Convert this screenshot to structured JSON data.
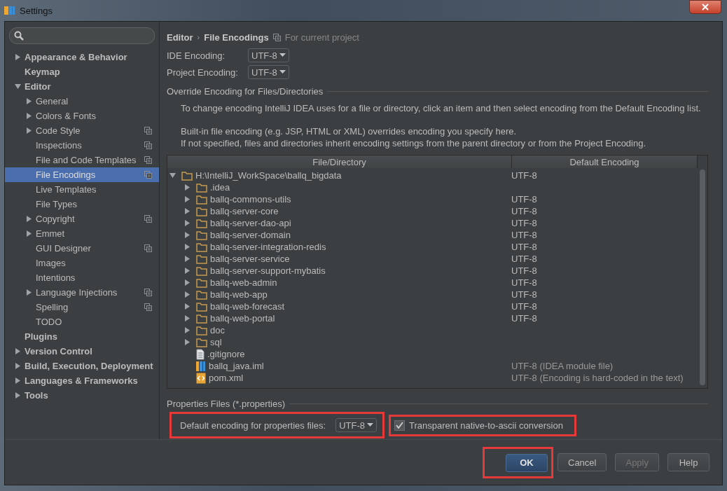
{
  "window": {
    "title": "Settings"
  },
  "sidebar": {
    "items": [
      {
        "label": "Appearance & Behavior",
        "expanded": false,
        "selected": false
      },
      {
        "label": "Keymap",
        "selected": false
      },
      {
        "label": "Editor",
        "expanded": true,
        "selected": false,
        "children": [
          {
            "label": "General",
            "expanded": false,
            "selected": false
          },
          {
            "label": "Colors & Fonts",
            "expanded": false,
            "selected": false
          },
          {
            "label": "Code Style",
            "expanded": false,
            "selected": false,
            "project_scoped": true
          },
          {
            "label": "Inspections",
            "selected": false,
            "project_scoped": true
          },
          {
            "label": "File and Code Templates",
            "selected": false,
            "project_scoped": true
          },
          {
            "label": "File Encodings",
            "selected": true,
            "project_scoped": true
          },
          {
            "label": "Live Templates",
            "selected": false
          },
          {
            "label": "File Types",
            "selected": false
          },
          {
            "label": "Copyright",
            "expanded": false,
            "selected": false,
            "project_scoped": true
          },
          {
            "label": "Emmet",
            "expanded": false,
            "selected": false
          },
          {
            "label": "GUI Designer",
            "selected": false,
            "project_scoped": true
          },
          {
            "label": "Images",
            "selected": false
          },
          {
            "label": "Intentions",
            "selected": false
          },
          {
            "label": "Language Injections",
            "expanded": false,
            "selected": false,
            "project_scoped": true
          },
          {
            "label": "Spelling",
            "selected": false,
            "project_scoped": true
          },
          {
            "label": "TODO",
            "selected": false
          }
        ]
      },
      {
        "label": "Plugins",
        "selected": false
      },
      {
        "label": "Version Control",
        "expanded": false,
        "selected": false
      },
      {
        "label": "Build, Execution, Deployment",
        "expanded": false,
        "selected": false
      },
      {
        "label": "Languages & Frameworks",
        "expanded": false,
        "selected": false
      },
      {
        "label": "Tools",
        "expanded": false,
        "selected": false
      }
    ]
  },
  "breadcrumb": {
    "items": [
      "Editor",
      "File Encodings"
    ],
    "separator": "›",
    "scope_note": "For current project"
  },
  "encodings": [
    {
      "label": "IDE Encoding:",
      "value": "UTF-8"
    },
    {
      "label": "Project Encoding:",
      "value": "UTF-8"
    }
  ],
  "override": {
    "title": "Override Encoding for Files/Directories",
    "description": [
      "To change encoding IntelliJ IDEA uses for a file or directory, click an item and then select encoding from the Default Encoding list.",
      "Built-in file encoding (e.g. JSP, HTML or XML) overrides encoding you specify here.\nIf not specified, files and directories inherit encoding settings from the parent directory or from the Project Encoding."
    ],
    "table": {
      "columns": [
        "File/Directory",
        "Default Encoding"
      ],
      "rows": [
        {
          "name": "H:\\IntelliJ_WorkSpace\\ballq_bigdata",
          "encoding": "UTF-8",
          "kind": "folder",
          "expanded": true,
          "children": [
            {
              "name": ".idea",
              "kind": "folder",
              "expanded": false
            },
            {
              "name": "ballq-commons-utils",
              "encoding": "UTF-8",
              "kind": "folder",
              "expanded": false
            },
            {
              "name": "ballq-server-core",
              "encoding": "UTF-8",
              "kind": "folder",
              "expanded": false
            },
            {
              "name": "ballq-server-dao-api",
              "encoding": "UTF-8",
              "kind": "folder",
              "expanded": false
            },
            {
              "name": "ballq-server-domain",
              "encoding": "UTF-8",
              "kind": "folder",
              "expanded": false
            },
            {
              "name": "ballq-server-integration-redis",
              "encoding": "UTF-8",
              "kind": "folder",
              "expanded": false
            },
            {
              "name": "ballq-server-service",
              "encoding": "UTF-8",
              "kind": "folder",
              "expanded": false
            },
            {
              "name": "ballq-server-support-mybatis",
              "encoding": "UTF-8",
              "kind": "folder",
              "expanded": false
            },
            {
              "name": "ballq-web-admin",
              "encoding": "UTF-8",
              "kind": "folder",
              "expanded": false
            },
            {
              "name": "ballq-web-app",
              "encoding": "UTF-8",
              "kind": "folder",
              "expanded": false
            },
            {
              "name": "ballq-web-forecast",
              "encoding": "UTF-8",
              "kind": "folder",
              "expanded": false
            },
            {
              "name": "ballq-web-portal",
              "encoding": "UTF-8",
              "kind": "folder",
              "expanded": false
            },
            {
              "name": "doc",
              "kind": "folder",
              "expanded": false
            },
            {
              "name": "sql",
              "kind": "folder",
              "expanded": false
            },
            {
              "name": ".gitignore",
              "kind": "text"
            },
            {
              "name": "ballq_java.iml",
              "encoding": "UTF-8 (IDEA module file)",
              "kind": "module",
              "dimmed": true
            },
            {
              "name": "pom.xml",
              "encoding": "UTF-8 (Encoding is hard-coded in the text)",
              "kind": "xml",
              "dimmed": true
            }
          ]
        }
      ]
    }
  },
  "properties": {
    "title": "Properties Files (*.properties)",
    "default_encoding": {
      "label": "Default encoding for properties files:",
      "value": "UTF-8",
      "highlighted": true
    },
    "native_to_ascii": {
      "label": "Transparent native-to-ascii conversion",
      "checked": true,
      "highlighted": true
    }
  },
  "buttons": [
    {
      "label": "OK",
      "primary": true,
      "disabled": false,
      "highlighted": true
    },
    {
      "label": "Cancel",
      "primary": false,
      "disabled": false,
      "highlighted": false
    },
    {
      "label": "Apply",
      "primary": false,
      "disabled": true,
      "highlighted": false
    },
    {
      "label": "Help",
      "primary": false,
      "disabled": false,
      "highlighted": false
    }
  ]
}
